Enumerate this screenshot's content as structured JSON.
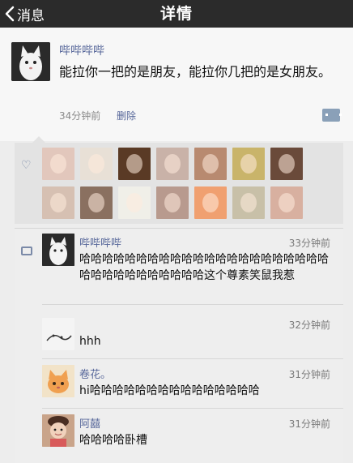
{
  "nav": {
    "back_label": "消息",
    "title": "详情"
  },
  "post": {
    "author": "哔哔哔哔",
    "content": "能拉你一把的是朋友，能拉你几把的是女朋友。",
    "time": "34分钟前",
    "delete_label": "删除"
  },
  "likes": {
    "avatars": [
      {
        "color": "#e2c7bc"
      },
      {
        "color": "#e8e0d6"
      },
      {
        "color": "#5a3a25"
      },
      {
        "color": "#c9b2a8"
      },
      {
        "color": "#b88a70"
      },
      {
        "color": "#c9b46a"
      },
      {
        "color": "#6a4a3a"
      },
      {
        "color": "#d6c0b2"
      },
      {
        "color": "#8a7060"
      },
      {
        "color": "#f0efe8"
      },
      {
        "color": "#b89a8e"
      },
      {
        "color": "#f0a070"
      },
      {
        "color": "#c8c0a8"
      },
      {
        "color": "#d8b0a0"
      }
    ]
  },
  "comments": [
    {
      "name": "哔哔哔哔",
      "time": "33分钟前",
      "text": "哈哈哈哈哈哈哈哈哈哈哈哈哈哈哈哈哈哈哈哈哈哈哈哈哈哈哈哈哈哈哈哈哈这个尊素笑鼠我惹"
    },
    {
      "name": "",
      "time": "32分钟前",
      "text": "hhh"
    },
    {
      "name": "卷花。",
      "time": "31分钟前",
      "text": "hi哈哈哈哈哈哈哈哈哈哈哈哈哈哈哈"
    },
    {
      "name": "阿囍",
      "time": "31分钟前",
      "text": "哈哈哈哈卧槽"
    }
  ]
}
